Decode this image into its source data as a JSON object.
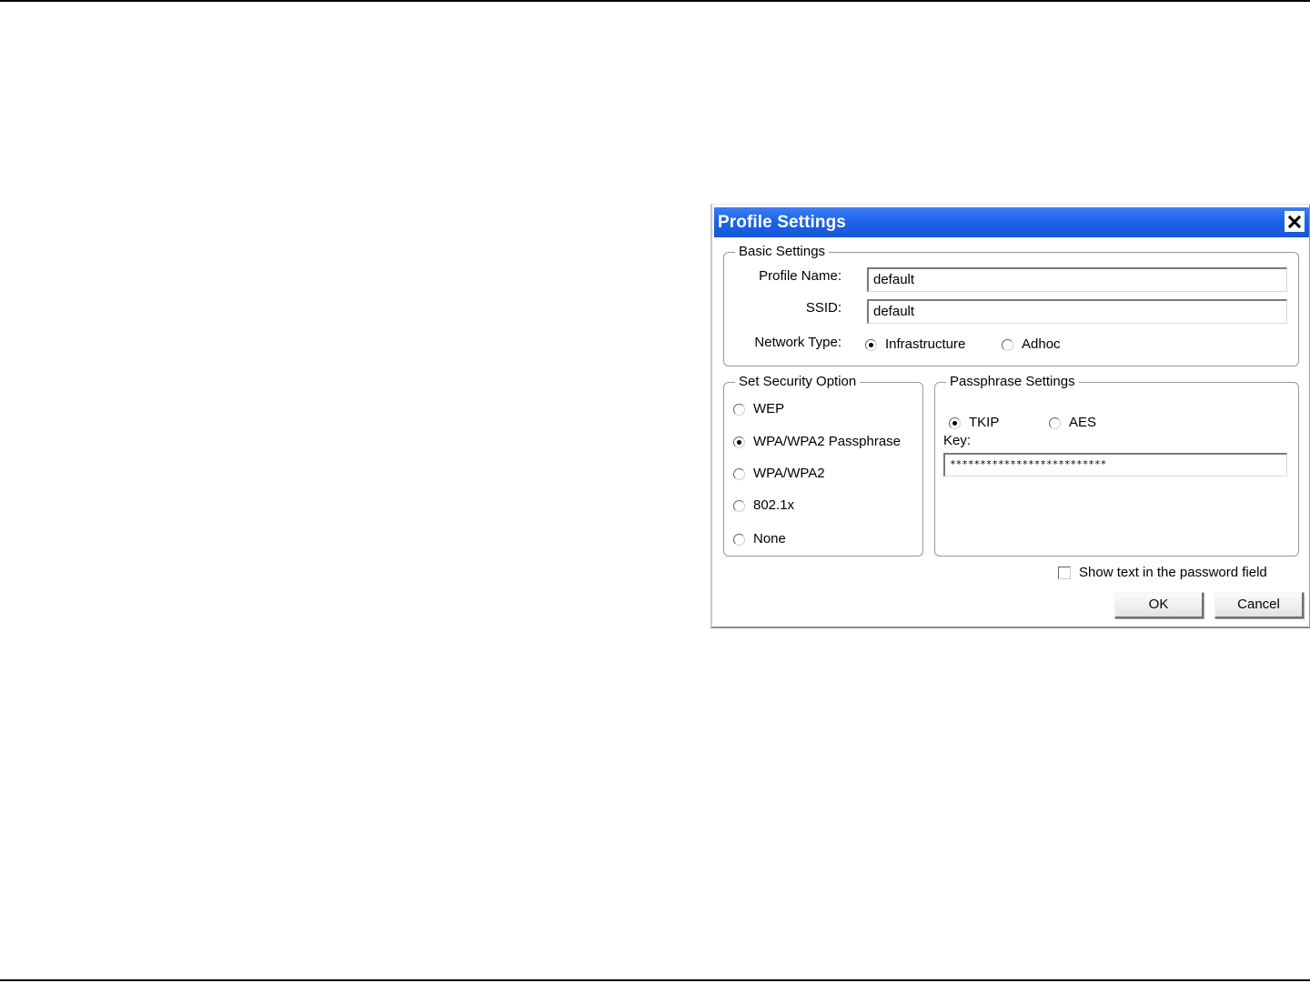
{
  "window": {
    "title": "Profile Settings",
    "close_icon": "close-icon"
  },
  "basic_settings": {
    "legend": "Basic Settings",
    "profile_name_label": "Profile Name:",
    "profile_name_value": "default",
    "ssid_label": "SSID:",
    "ssid_value": "default",
    "network_type_label": "Network Type:",
    "network_type_options": [
      {
        "label": "Infrastructure",
        "checked": true
      },
      {
        "label": "Adhoc",
        "checked": false
      }
    ]
  },
  "security": {
    "legend": "Set Security Option",
    "options": [
      {
        "label": "WEP",
        "checked": false
      },
      {
        "label": "WPA/WPA2 Passphrase",
        "checked": true
      },
      {
        "label": "WPA/WPA2",
        "checked": false
      },
      {
        "label": "802.1x",
        "checked": false
      },
      {
        "label": "None",
        "checked": false
      }
    ]
  },
  "passphrase": {
    "legend": "Passphrase Settings",
    "cipher_options": [
      {
        "label": "TKIP",
        "checked": true
      },
      {
        "label": "AES",
        "checked": false
      }
    ],
    "key_label": "Key:",
    "key_value": "**************************"
  },
  "show_text": {
    "label": "Show text in the password field",
    "checked": false
  },
  "buttons": {
    "ok_label": "OK",
    "cancel_label": "Cancel"
  }
}
